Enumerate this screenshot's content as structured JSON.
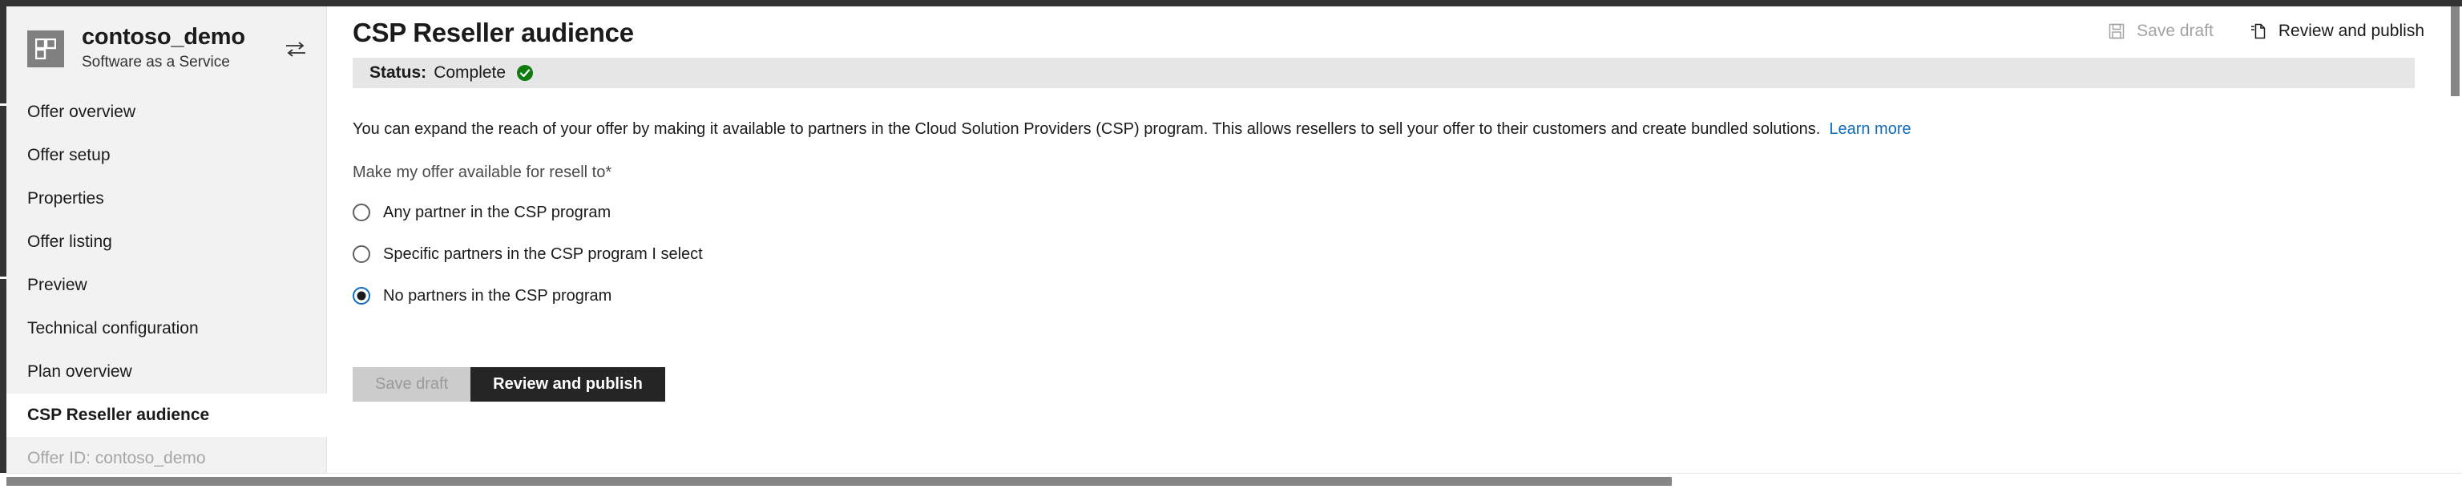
{
  "offer": {
    "icon_name": "grid-tile-icon",
    "name": "contoso_demo",
    "subtitle": "Software as a Service",
    "switch_icon_name": "swap-offer-icon"
  },
  "sidebar": {
    "items": [
      {
        "label": "Offer overview",
        "active": false,
        "muted": false
      },
      {
        "label": "Offer setup",
        "active": false,
        "muted": false
      },
      {
        "label": "Properties",
        "active": false,
        "muted": false
      },
      {
        "label": "Offer listing",
        "active": false,
        "muted": false
      },
      {
        "label": "Preview",
        "active": false,
        "muted": false
      },
      {
        "label": "Technical configuration",
        "active": false,
        "muted": false
      },
      {
        "label": "Plan overview",
        "active": false,
        "muted": false
      },
      {
        "label": "CSP Reseller audience",
        "active": true,
        "muted": false
      },
      {
        "label": "Offer ID: contoso_demo",
        "active": false,
        "muted": true
      }
    ]
  },
  "header": {
    "title": "CSP Reseller audience",
    "save_draft_label": "Save draft",
    "save_draft_icon": "save-floppy-icon",
    "review_publish_label": "Review and publish",
    "review_publish_icon": "publish-document-icon"
  },
  "status": {
    "label": "Status:",
    "value": "Complete",
    "icon_name": "green-check-circle-icon",
    "color": "#107c10"
  },
  "content": {
    "intro_text": "You can expand the reach of your offer by making it available to partners in the Cloud Solution Providers (CSP) program. This allows resellers to sell your offer to their customers and create bundled solutions.",
    "learn_more_label": "Learn more",
    "learn_more_color": "#0f6cbd",
    "field_label": "Make my offer available for resell to*",
    "radio_options": [
      {
        "label": "Any partner in the CSP program",
        "selected": false
      },
      {
        "label": "Specific partners in the CSP program I select",
        "selected": false
      },
      {
        "label": "No partners in the CSP program",
        "selected": true
      }
    ]
  },
  "footer": {
    "save_draft_label": "Save draft",
    "review_publish_label": "Review and publish"
  }
}
